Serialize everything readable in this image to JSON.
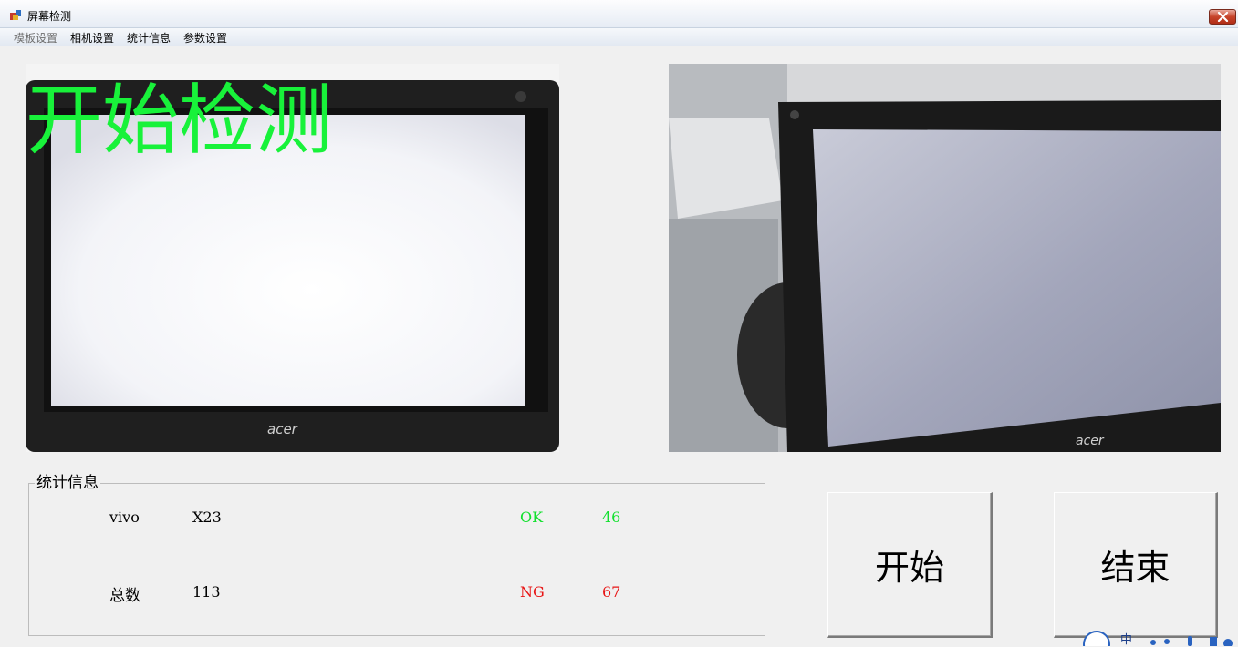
{
  "window": {
    "title": "屏幕检测",
    "app_icon": "app-icon",
    "close_icon": "close-icon"
  },
  "menu": [
    {
      "label": "模板设置",
      "enabled": false
    },
    {
      "label": "相机设置",
      "enabled": true
    },
    {
      "label": "统计信息",
      "enabled": true
    },
    {
      "label": "参数设置",
      "enabled": true
    }
  ],
  "camera_left": {
    "overlay_text": "开始检测",
    "overlay_color": "#18f23a",
    "brand": "acer"
  },
  "camera_right": {
    "brand": "acer"
  },
  "stats": {
    "group_title": "统计信息",
    "model_brand": "vivo",
    "model_name": "X23",
    "ok_label": "OK",
    "ok_value": "46",
    "total_label": "总数",
    "total_value": "113",
    "ng_label": "NG",
    "ng_value": "67",
    "ok_color": "#12e02e",
    "ng_color": "#e81515"
  },
  "buttons": {
    "start": "开始",
    "end": "结束"
  },
  "tray": {
    "ime_label": "中"
  }
}
